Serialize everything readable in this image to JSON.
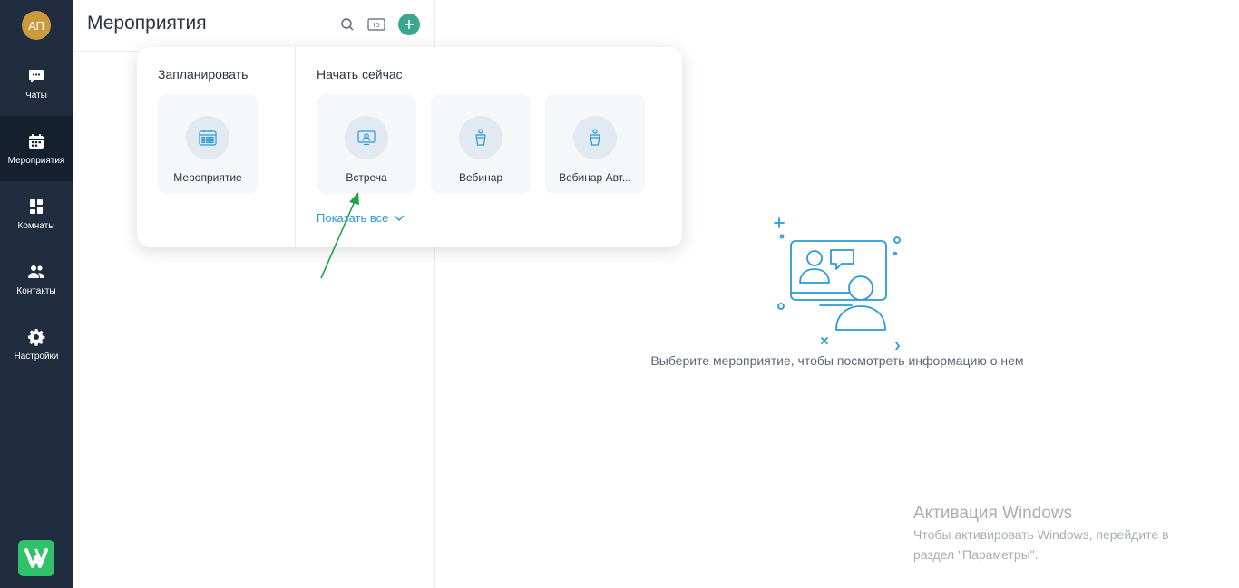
{
  "user": {
    "initials": "АП"
  },
  "sidebar": {
    "items": [
      {
        "label": "Чаты",
        "icon": "chat-icon"
      },
      {
        "label": "Мероприятия",
        "icon": "calendar-icon",
        "active": true
      },
      {
        "label": "Комнаты",
        "icon": "rooms-icon"
      },
      {
        "label": "Контакты",
        "icon": "contacts-icon"
      },
      {
        "label": "Настройки",
        "icon": "gear-icon"
      }
    ],
    "logo_icon": "brand-logo-icon"
  },
  "header": {
    "title": "Мероприятия",
    "id_badge": "ID",
    "buttons": [
      "search-icon",
      "id-icon",
      "plus-icon"
    ]
  },
  "popover": {
    "schedule_heading": "Запланировать",
    "start_heading": "Начать сейчас",
    "schedule_tiles": [
      {
        "label": "Мероприятие",
        "icon": "calendar-grid-icon"
      }
    ],
    "start_tiles": [
      {
        "label": "Встреча",
        "icon": "meeting-icon"
      },
      {
        "label": "Вебинар",
        "icon": "webinar-icon"
      },
      {
        "label": "Вебинар Авт...",
        "icon": "webinar-auto-icon"
      }
    ],
    "show_all": "Показать все"
  },
  "empty_state": {
    "message": "Выберите мероприятие, чтобы посмотреть информацию о нем",
    "illustration": "video-conference-illustration"
  },
  "windows_watermark": {
    "title": "Активация Windows",
    "line1": "Чтобы активировать Windows, перейдите в",
    "line2": "раздел \"Параметры\"."
  },
  "colors": {
    "sidebar_bg": "#1f2d3f",
    "sidebar_active": "#15202e",
    "accent_teal": "#3aa68f",
    "link_blue": "#2a9bd6",
    "avatar_bg": "#c99a3e",
    "brand_green": "#2fc26b"
  }
}
